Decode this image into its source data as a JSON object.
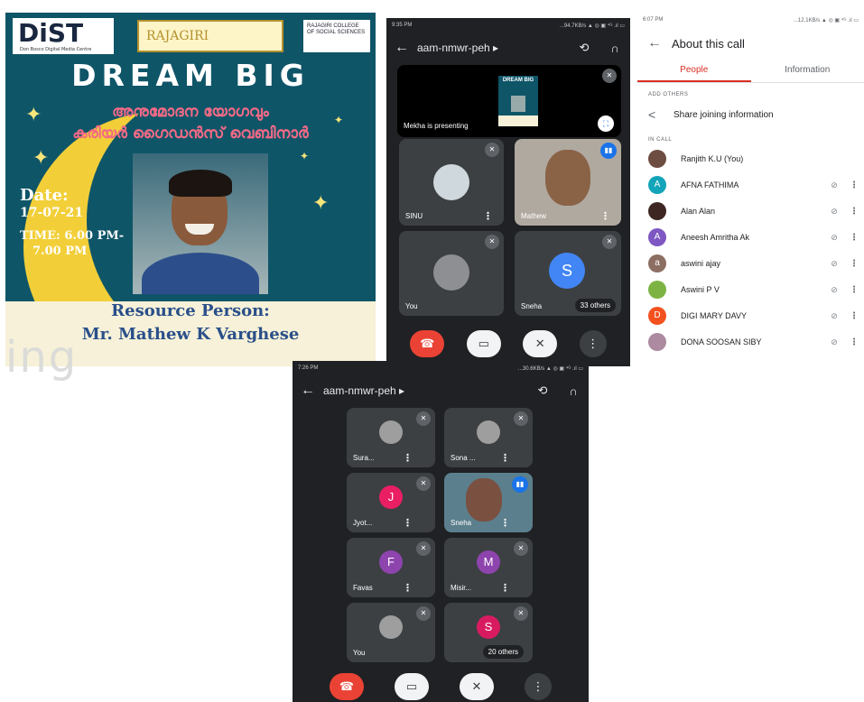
{
  "poster": {
    "logo_dist": "DiST",
    "logo_dist_sub": "Don Bosco Digital Media Centre",
    "logo_rajagiri": "RAJAGIRI",
    "logo_right": "RAJAGIRI COLLEGE OF SOCIAL SCIENCES",
    "title": "DREAM BIG",
    "malayalam_line1": "അനുമോദന യോഗവും",
    "malayalam_line2": "കരിയർ ഗൈഡൻസ് വെബിനാർ",
    "date_label": "Date:",
    "date_value": "17-07-21",
    "time_line1": "TIME: 6.00 PM-",
    "time_line2": "7.00 PM",
    "resource_label": "Resource Person:",
    "resource_name": "Mr. Mathew K Varghese"
  },
  "overlay_text": "ing",
  "meet1": {
    "status_time": "9:35 PM",
    "status_right": "...94.7KB/s ▲ ◎ ▣ ⁴ᴳ .ıl ▭",
    "meeting_code": "aam-nmwr-peh ▸",
    "presenter_text": "Mekha is presenting",
    "tiles": [
      {
        "name": "SINU"
      },
      {
        "name": "Mathew"
      },
      {
        "name": "You"
      },
      {
        "name": "Sneha",
        "letter": "S",
        "others": "33 others"
      }
    ]
  },
  "people": {
    "status_time": "6:07 PM",
    "status_right": "...12.1KB/s ▲ ◎ ▣ ⁴ᴳ .ıl ▭",
    "header": "About this call",
    "tabs": [
      "People",
      "Information"
    ],
    "add_others": "ADD OTHERS",
    "share": "Share joining information",
    "in_call": "IN CALL",
    "rows": [
      {
        "name": "Ranjith K.U (You)",
        "letter": "",
        "color": "#6d4c41"
      },
      {
        "name": "AFNA FATHIMA",
        "letter": "A",
        "color": "#12a4b8"
      },
      {
        "name": "Alan Alan",
        "letter": "",
        "color": "#3e2723"
      },
      {
        "name": "Aneesh Amritha Ak",
        "letter": "A",
        "color": "#7e57c2"
      },
      {
        "name": "aswini ajay",
        "letter": "a",
        "color": "#8d6e63"
      },
      {
        "name": "Aswini P V",
        "letter": "",
        "color": "#7cb342"
      },
      {
        "name": "DIGI MARY DAVY",
        "letter": "D",
        "color": "#f4511e"
      },
      {
        "name": "DONA SOOSAN SIBY",
        "letter": "",
        "color": "#ad8aa0"
      }
    ]
  },
  "meet2": {
    "status_time": "7:26 PM",
    "status_right": "...30.6KB/s ▲ ◎ ▣ ⁴ᴳ .ıl ▭",
    "meeting_code": "aam-nmwr-peh ▸",
    "tiles": [
      {
        "name": "Sura..."
      },
      {
        "name": "Sona ..."
      },
      {
        "name": "Jyot...",
        "letter": "J",
        "color": "#e91e63"
      },
      {
        "name": "Sneha"
      },
      {
        "name": "Favas",
        "letter": "F",
        "color": "#8e44ad"
      },
      {
        "name": "Misir...",
        "letter": "M",
        "color": "#8e44ad"
      },
      {
        "name": "You"
      },
      {
        "name": "",
        "letter": "S",
        "color": "#d81b60",
        "others": "20 others"
      }
    ]
  }
}
